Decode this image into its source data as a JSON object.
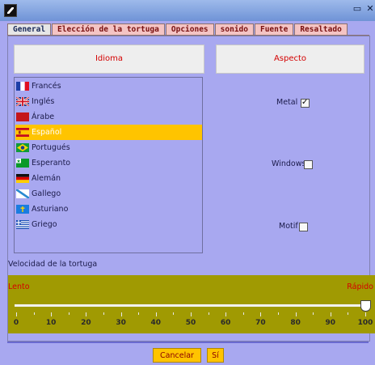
{
  "window": {
    "minimize_glyph": "▭",
    "close_glyph": "✕"
  },
  "tabs": [
    "General",
    "Elección de la tortuga",
    "Opciones",
    "sonido",
    "Fuente",
    "Resaltado"
  ],
  "idioma": {
    "title": "Idioma",
    "items": [
      {
        "label": "Francés",
        "flag": "fr"
      },
      {
        "label": "Inglés",
        "flag": "uk"
      },
      {
        "label": "Árabe",
        "flag": "ar"
      },
      {
        "label": "Español",
        "flag": "es",
        "selected": true
      },
      {
        "label": "Portugués",
        "flag": "br"
      },
      {
        "label": "Esperanto",
        "flag": "eo"
      },
      {
        "label": "Alemán",
        "flag": "de"
      },
      {
        "label": "Gallego",
        "flag": "gl"
      },
      {
        "label": "Asturiano",
        "flag": "as"
      },
      {
        "label": "Griego",
        "flag": "gr"
      }
    ]
  },
  "aspecto": {
    "title": "Aspecto",
    "options": [
      {
        "label": "Metal",
        "checked": true
      },
      {
        "label": "Windows",
        "checked": false
      },
      {
        "label": "Motif",
        "checked": false
      }
    ]
  },
  "speed": {
    "label": "Velocidad de la tortuga",
    "min_label": "Lento",
    "max_label": "Rápido",
    "value": 100,
    "ticks": [
      "0",
      "10",
      "20",
      "30",
      "40",
      "50",
      "60",
      "70",
      "80",
      "90",
      "100"
    ]
  },
  "buttons": {
    "cancel": "Cancelar",
    "ok": "Sí"
  },
  "colors": {
    "accent": "#ffc400",
    "background": "#a8a8f0",
    "slider": "#a09a02",
    "tab_text": "#7a1111"
  }
}
